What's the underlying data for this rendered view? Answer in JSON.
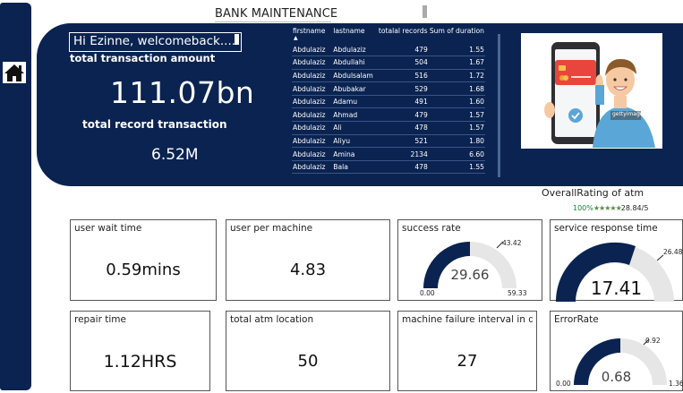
{
  "page": {
    "title": "BANK MAINTENANCE"
  },
  "nav": {
    "home_icon": "home-icon"
  },
  "banner": {
    "greeting": "Hi Ezinne, welcomeback....",
    "amount_label": "total transaction amount",
    "amount_value": "111.07bn",
    "records_label": "total record transaction",
    "records_value": "6.52M"
  },
  "table": {
    "headers": [
      "firstname",
      "lastname",
      "totalal records",
      "Sum of duration"
    ],
    "rows": [
      [
        "Abdulaziz",
        "Abdulaziz",
        "479",
        "1.55"
      ],
      [
        "Abdulaziz",
        "Abdullahi",
        "504",
        "1.67"
      ],
      [
        "Abdulaziz",
        "Abdulsalam",
        "516",
        "1.72"
      ],
      [
        "Abdulaziz",
        "Abubakar",
        "529",
        "1.68"
      ],
      [
        "Abdulaziz",
        "Adamu",
        "491",
        "1.60"
      ],
      [
        "Abdulaziz",
        "Ahmad",
        "479",
        "1.57"
      ],
      [
        "Abdulaziz",
        "Ali",
        "478",
        "1.57"
      ],
      [
        "Abdulaziz",
        "Aliyu",
        "521",
        "1.80"
      ],
      [
        "Abdulaziz",
        "Amina",
        "2134",
        "6.60"
      ],
      [
        "Abdulaziz",
        "Bala",
        "478",
        "1.55"
      ]
    ]
  },
  "illustration": {
    "stock_text": "gettyimages"
  },
  "rating": {
    "title": "OverallRating of atm",
    "percent": "100%",
    "stars": "★★★★★",
    "value": "28.84/5"
  },
  "cards": {
    "wait_time": {
      "label": "user wait time",
      "value": "0.59mins"
    },
    "per_machine": {
      "label": "user per machine",
      "value": "4.83"
    },
    "success_rate": {
      "label": "success rate",
      "value": "29.66",
      "min": "0.00",
      "max": "59.33",
      "target": "43.42"
    },
    "service_response": {
      "label": "service response time",
      "value": "17.41",
      "target": "26.48"
    },
    "repair_time": {
      "label": "repair time",
      "value": "1.12HRS"
    },
    "atm_location": {
      "label": "total atm location",
      "value": "50"
    },
    "failure_interval": {
      "label": "machine failure interval in d...",
      "value": "27"
    },
    "error_rate": {
      "label": "ErrorRate",
      "value": "0.68",
      "min": "0.00",
      "max": "1.36",
      "target": "0.92"
    }
  },
  "colors": {
    "navy": "#0a2351",
    "gauge_bg": "#e6e6e6",
    "gauge_fill": "#0a2351",
    "phone_card": "#e8463d",
    "shirt": "#5aa6d6"
  }
}
